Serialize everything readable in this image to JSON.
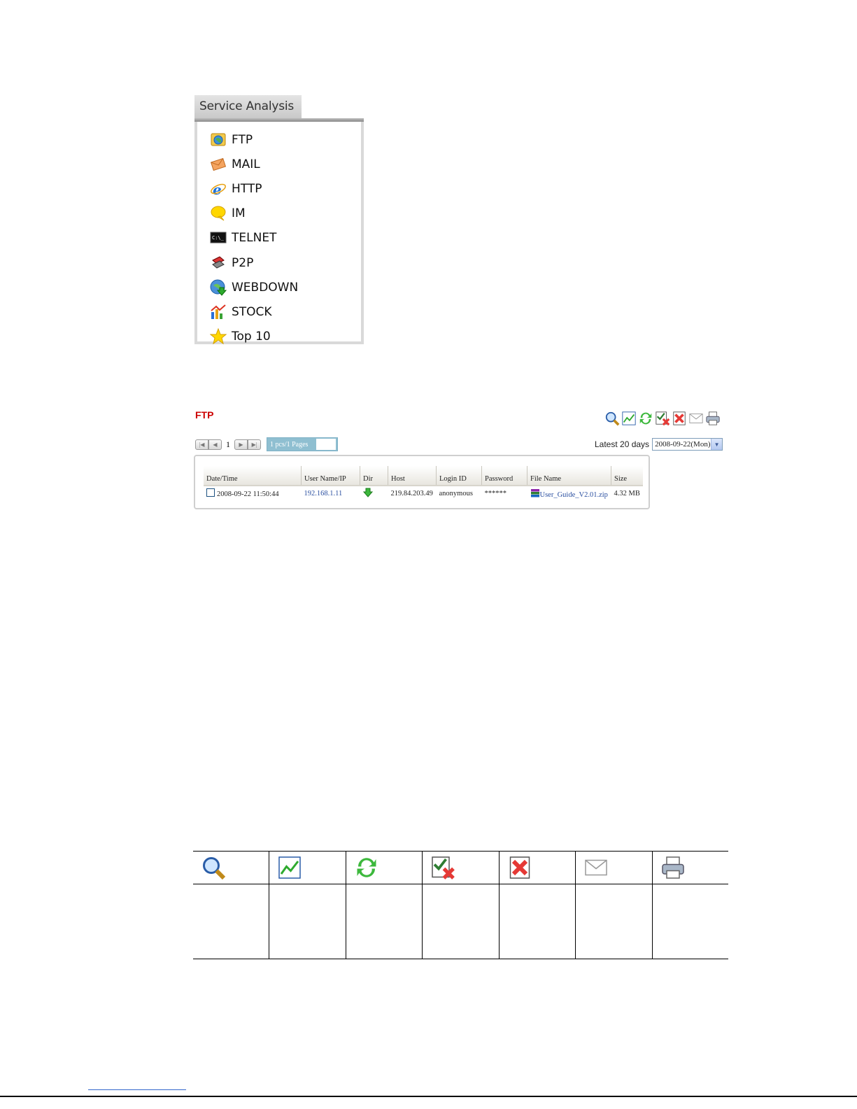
{
  "service_analysis": {
    "title": "Service Analysis",
    "items": [
      {
        "label": "FTP",
        "icon": "ftp-icon"
      },
      {
        "label": "MAIL",
        "icon": "mail-icon"
      },
      {
        "label": "HTTP",
        "icon": "http-icon"
      },
      {
        "label": "IM",
        "icon": "im-icon"
      },
      {
        "label": "TELNET",
        "icon": "telnet-icon"
      },
      {
        "label": "P2P",
        "icon": "p2p-icon"
      },
      {
        "label": "WEBDOWN",
        "icon": "webdown-icon"
      },
      {
        "label": "STOCK",
        "icon": "stock-icon"
      },
      {
        "label": "Top 10",
        "icon": "star-icon"
      }
    ]
  },
  "ftp": {
    "title": "FTP",
    "toolbar": [
      "search-icon",
      "chart-icon",
      "refresh-icon",
      "delete-selected-icon",
      "delete-all-icon",
      "mail-icon",
      "print-icon"
    ],
    "pager": {
      "page": "1",
      "info": "1 pcs/1 Pages"
    },
    "latest_label": "Latest 20 days",
    "date_selected": "2008-09-22(Mon)",
    "columns": [
      "Date/Time",
      "User Name/IP",
      "Dir",
      "Host",
      "Login ID",
      "Password",
      "File Name",
      "Size"
    ],
    "rows": [
      {
        "datetime": "2008-09-22 11:50:44",
        "user": "192.168.1.11",
        "dir": "download-arrow-icon",
        "host": "219.84.203.49",
        "login": "anonymous",
        "password": "******",
        "file": "User_Guide_V2.01.zip",
        "size": "4.32 MB"
      }
    ]
  },
  "legend_icons": [
    "search-icon",
    "chart-icon",
    "refresh-icon",
    "delete-selected-icon",
    "delete-all-icon",
    "mail-icon",
    "print-icon"
  ],
  "colors": {
    "ftp_title": "#cc0000",
    "link": "#2a4fa0",
    "pager_info_bg": "#8fbfd1"
  }
}
